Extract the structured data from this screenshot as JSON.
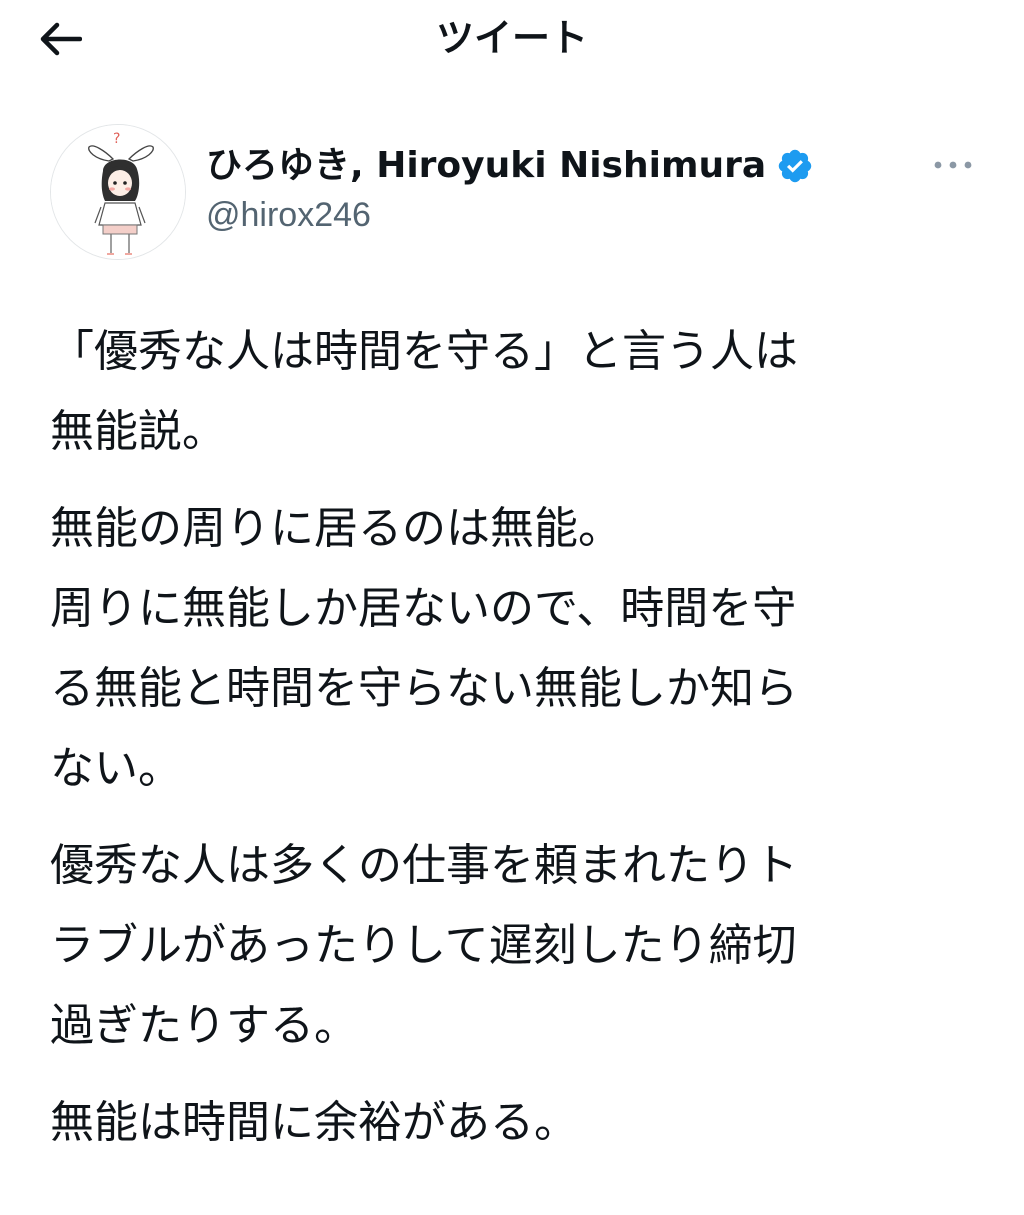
{
  "header": {
    "title": "ツイート",
    "back_icon": "arrow-left-icon"
  },
  "author": {
    "name": "ひろゆき, Hiroyuki Nishimura",
    "handle": "@hirox246",
    "verified": true,
    "verified_color": "#1d9bf0",
    "avatar_icon": "bunny-ear-character-avatar"
  },
  "more_icon": "more-horizontal-icon",
  "tweet": {
    "paragraphs": [
      {
        "lines": [
          "「優秀な人は時間を守る」と言う人は",
          "無能説。"
        ]
      },
      {
        "lines": [
          "無能の周りに居るのは無能。",
          "周りに無能しか居ないので、時間を守",
          "る無能と時間を守らない無能しか知ら",
          "ない。"
        ]
      },
      {
        "lines": [
          "優秀な人は多くの仕事を頼まれたりト",
          "ラブルがあったりして遅刻したり締切",
          "過ぎたりする。"
        ]
      },
      {
        "lines": [
          "無能は時間に余裕がある。"
        ]
      }
    ]
  },
  "colors": {
    "text": "#0f1419",
    "secondary_text": "#536471",
    "background": "#ffffff"
  }
}
